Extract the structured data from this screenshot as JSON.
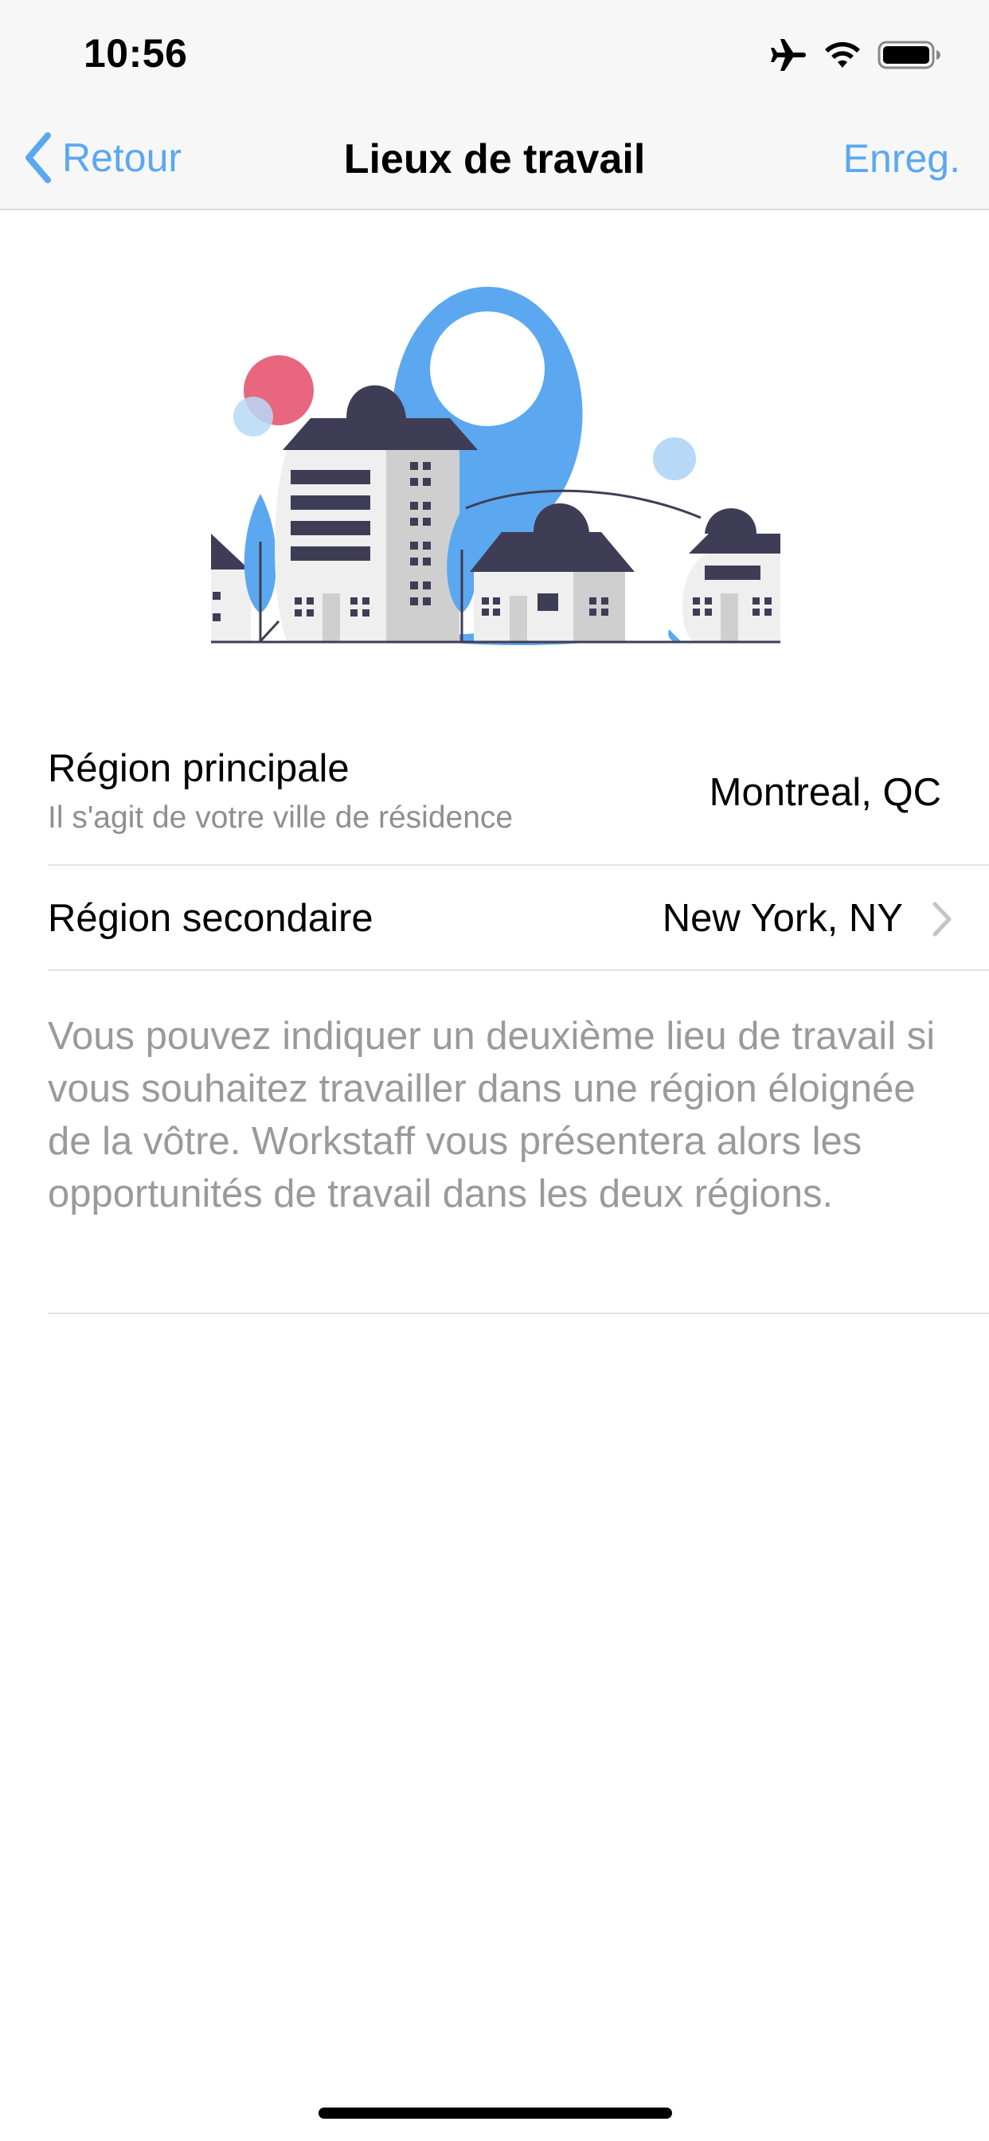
{
  "status_bar": {
    "time": "10:56",
    "icons": [
      "airplane-icon",
      "wifi-icon",
      "battery-icon"
    ]
  },
  "nav": {
    "back_label": "Retour",
    "title": "Lieux de travail",
    "save_label": "Enreg."
  },
  "regions": {
    "primary": {
      "label": "Région principale",
      "sublabel": "Il s'agit de votre ville de résidence",
      "value": "Montreal, QC"
    },
    "secondary": {
      "label": "Région secondaire",
      "value": "New York, NY"
    }
  },
  "description": "Vous pouvez indiquer un deuxième lieu de travail si vous souhaitez travailler dans une région éloignée de la vôtre. Workstaff vous présentera alors les opportunités de travail dans les deux régions.",
  "colors": {
    "accent": "#5ba8f1",
    "illustration_dark": "#3f3d56",
    "illustration_pink": "#e8677e",
    "illustration_light_blue": "#b7d9f7"
  }
}
